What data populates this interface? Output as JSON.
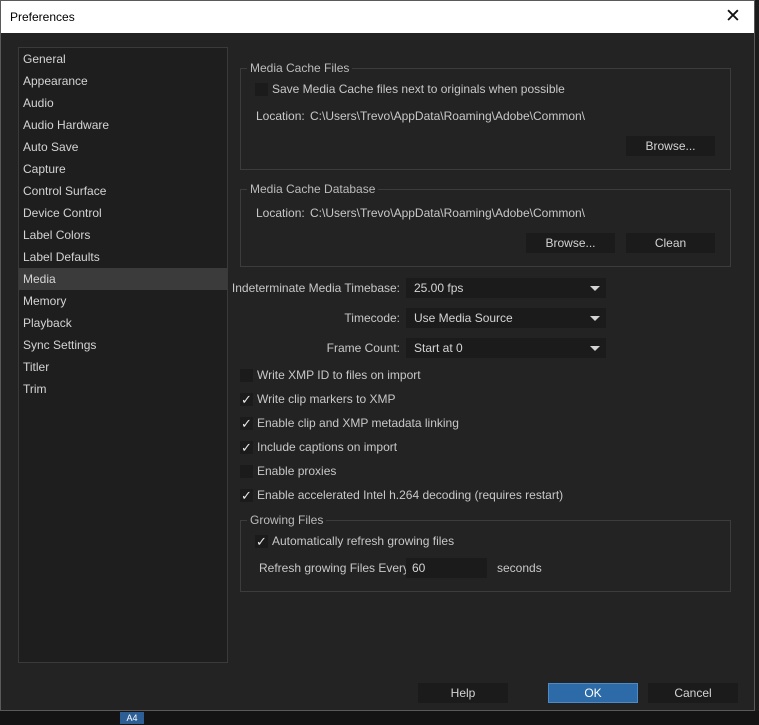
{
  "window": {
    "title": "Preferences"
  },
  "sidebar": {
    "items": [
      {
        "label": "General"
      },
      {
        "label": "Appearance"
      },
      {
        "label": "Audio"
      },
      {
        "label": "Audio Hardware"
      },
      {
        "label": "Auto Save"
      },
      {
        "label": "Capture"
      },
      {
        "label": "Control Surface"
      },
      {
        "label": "Device Control"
      },
      {
        "label": "Label Colors"
      },
      {
        "label": "Label Defaults"
      },
      {
        "label": "Media",
        "selected": true
      },
      {
        "label": "Memory"
      },
      {
        "label": "Playback"
      },
      {
        "label": "Sync Settings"
      },
      {
        "label": "Titler"
      },
      {
        "label": "Trim"
      }
    ]
  },
  "media_cache_files": {
    "title": "Media Cache Files",
    "save_next_label": "Save Media Cache files next to originals when possible",
    "save_next_checked": false,
    "location_label": "Location:",
    "location_value": "C:\\Users\\Trevo\\AppData\\Roaming\\Adobe\\Common\\",
    "browse_label": "Browse..."
  },
  "media_cache_db": {
    "title": "Media Cache Database",
    "location_label": "Location:",
    "location_value": "C:\\Users\\Trevo\\AppData\\Roaming\\Adobe\\Common\\",
    "browse_label": "Browse...",
    "clean_label": "Clean"
  },
  "timebase": {
    "label": "Indeterminate Media Timebase:",
    "value": "25.00 fps"
  },
  "timecode": {
    "label": "Timecode:",
    "value": "Use Media Source"
  },
  "frame_count": {
    "label": "Frame Count:",
    "value": "Start at 0"
  },
  "checkboxes": [
    {
      "label": "Write XMP ID to files on import",
      "checked": false
    },
    {
      "label": "Write clip markers to XMP",
      "checked": true
    },
    {
      "label": "Enable clip and XMP metadata linking",
      "checked": true
    },
    {
      "label": "Include captions on import",
      "checked": true
    },
    {
      "label": "Enable proxies",
      "checked": false
    },
    {
      "label": "Enable accelerated Intel h.264 decoding (requires restart)",
      "checked": true
    }
  ],
  "growing_files": {
    "title": "Growing Files",
    "auto_refresh_label": "Automatically refresh growing files",
    "auto_refresh_checked": true,
    "refresh_label": "Refresh growing Files Every",
    "refresh_value": "60",
    "refresh_unit": "seconds"
  },
  "footer": {
    "help_label": "Help",
    "ok_label": "OK",
    "cancel_label": "Cancel"
  },
  "check_glyph": "✓",
  "close_glyph": "✕",
  "taskbar": {
    "label": "A4"
  }
}
